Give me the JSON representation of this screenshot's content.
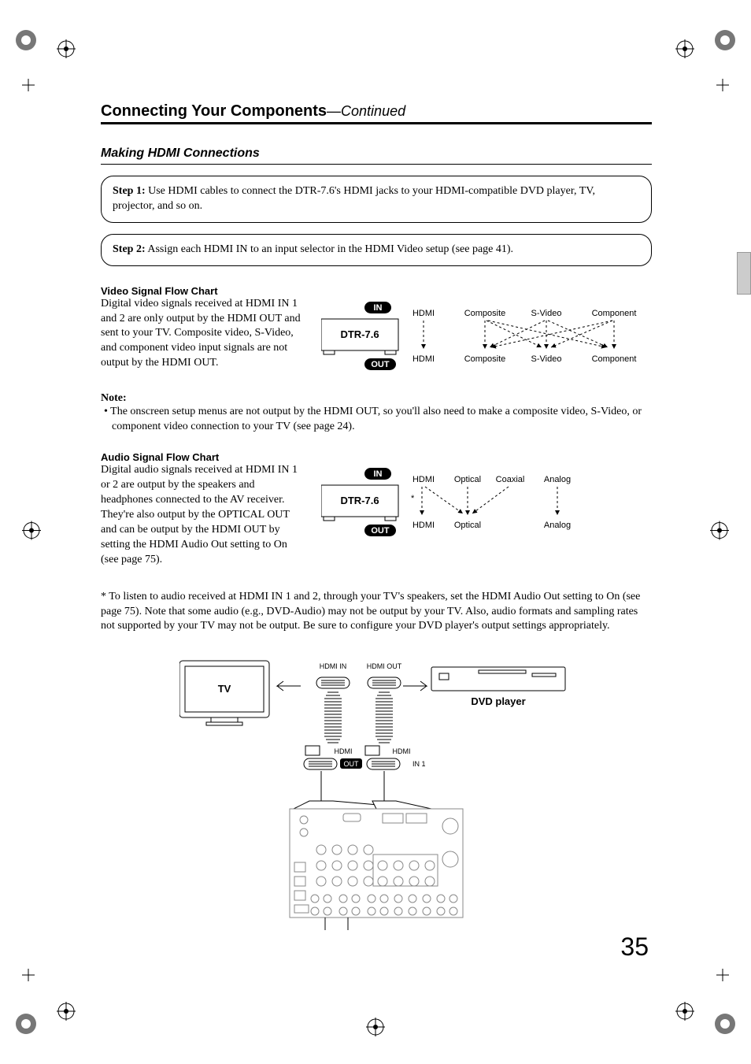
{
  "page_number": "35",
  "heading": {
    "main": "Connecting Your Components",
    "continued": "—Continued"
  },
  "section": "Making HDMI Connections",
  "steps": {
    "s1_label": "Step 1:",
    "s1_text": " Use HDMI cables to connect the DTR-7.6's HDMI jacks to your HDMI-compatible DVD player, TV, projector, and so on.",
    "s2_label": "Step 2:",
    "s2_text": " Assign each HDMI IN to an input selector in the HDMI Video setup (see page 41)."
  },
  "video": {
    "title": "Video Signal Flow Chart",
    "body": "Digital video signals received at HDMI IN 1 and 2 are only output by the HDMI OUT and sent to your TV. Composite video, S-Video, and component video input signals are not output by the HDMI OUT."
  },
  "note": {
    "title": "Note:",
    "body": "•  The onscreen setup menus are not output by the HDMI OUT, so you'll also need to make a composite video, S-Video, or component video connection to your TV (see page 24)."
  },
  "audio": {
    "title": "Audio Signal Flow Chart",
    "body": "Digital audio signals received at HDMI IN 1 or 2 are output by the speakers and headphones connected to the AV receiver. They're also output by the OPTICAL OUT and can be output by the HDMI OUT by setting the HDMI Audio Out setting to On (see page 75)."
  },
  "asterisk_note": "* To listen to audio received at HDMI IN 1 and 2, through your TV's speakers, set the HDMI Audio Out setting to On (see page 75). Note that some audio (e.g., DVD-Audio) may not be output by your TV. Also, audio formats and sampling rates not supported by your TV may not be output. Be sure to configure your DVD player's output settings appropriately.",
  "diagram": {
    "device": "DTR-7.6",
    "in": "IN",
    "out": "OUT",
    "video_in": [
      "HDMI",
      "Composite",
      "S-Video",
      "Component"
    ],
    "video_out": [
      "HDMI",
      "Composite",
      "S-Video",
      "Component"
    ],
    "audio_in": [
      "HDMI",
      "Optical",
      "Coaxial",
      "Analog"
    ],
    "audio_out": [
      "HDMI",
      "Optical",
      "Analog"
    ]
  },
  "hookup": {
    "tv": "TV",
    "dvd": "DVD player",
    "hdmi_in": "HDMI\nIN",
    "hdmi_out": "HDMI\nOUT",
    "hdmi": "HDMI",
    "in1": "IN 1",
    "out": "OUT"
  }
}
